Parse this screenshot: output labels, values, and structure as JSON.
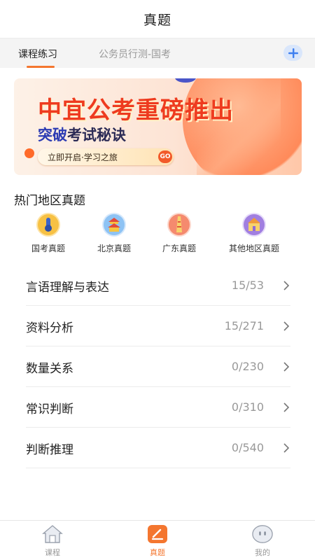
{
  "header": {
    "title": "真题"
  },
  "tabs": {
    "active_label": "课程练习",
    "inactive_label": "公务员行测-国考"
  },
  "banner": {
    "headline": "中宜公考重磅推出",
    "sub_highlight": "突破",
    "sub_rest": "考试秘诀",
    "cta": "立即开启·学习之旅",
    "go": "GO"
  },
  "regions_section": {
    "title": "热门地区真题",
    "items": [
      {
        "label": "国考真题",
        "icon": "national-exam-icon",
        "color": "#f6b82b"
      },
      {
        "label": "北京真题",
        "icon": "beijing-temple-icon",
        "color": "#4a90e2"
      },
      {
        "label": "广东真题",
        "icon": "guangdong-tower-icon",
        "color": "#f06a4a"
      },
      {
        "label": "其他地区真题",
        "icon": "other-regions-icon",
        "color": "#8e6bd6"
      }
    ]
  },
  "categories": [
    {
      "label": "言语理解与表达",
      "count": "15/53"
    },
    {
      "label": "资料分析",
      "count": "15/271"
    },
    {
      "label": "数量关系",
      "count": "0/230"
    },
    {
      "label": "常识判断",
      "count": "0/310"
    },
    {
      "label": "判断推理",
      "count": "0/540"
    }
  ],
  "bottom_nav": {
    "items": [
      {
        "label": "课程",
        "icon": "home-icon"
      },
      {
        "label": "真题",
        "icon": "exam-edit-icon",
        "active": true
      },
      {
        "label": "我的",
        "icon": "profile-face-icon"
      }
    ]
  },
  "colors": {
    "accent": "#f4762f",
    "banner_red": "#ee3b1f",
    "banner_blue": "#2c3bb3"
  }
}
